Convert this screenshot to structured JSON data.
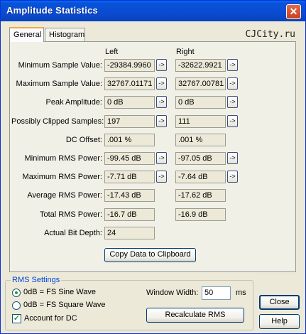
{
  "window": {
    "title": "Amplitude Statistics",
    "close_glyph": "✕"
  },
  "tabs": [
    {
      "label": "General",
      "active": true
    },
    {
      "label": "Histogram",
      "active": false
    }
  ],
  "watermark": "CJCity.ru",
  "columns": {
    "left": "Left",
    "right": "Right"
  },
  "arrow_label": "->",
  "rows": [
    {
      "label": "Minimum Sample Value:",
      "left": "-29384.9960",
      "right": "-32622.9921",
      "has_arrow": true
    },
    {
      "label": "Maximum Sample Value:",
      "left": "32767.01171",
      "right": "32767.00781",
      "has_arrow": true
    },
    {
      "label": "Peak Amplitude:",
      "left": "0 dB",
      "right": "0 dB",
      "has_arrow": true
    },
    {
      "label": "Possibly Clipped Samples:",
      "left": "197",
      "right": "111",
      "has_arrow": true
    },
    {
      "label": "DC Offset:",
      "left": ".001 %",
      "right": ".001 %",
      "has_arrow": false
    },
    {
      "label": "Minimum RMS Power:",
      "left": "-99.45 dB",
      "right": "-97.05 dB",
      "has_arrow": true
    },
    {
      "label": "Maximum RMS Power:",
      "left": "-7.71 dB",
      "right": "-7.64 dB",
      "has_arrow": true
    },
    {
      "label": "Average RMS Power:",
      "left": "-17.43 dB",
      "right": "-17.62 dB",
      "has_arrow": false
    },
    {
      "label": "Total RMS Power:",
      "left": "-16.7 dB",
      "right": "-16.9 dB",
      "has_arrow": false
    },
    {
      "label": "Actual Bit Depth:",
      "left": "24",
      "right": null,
      "has_arrow": false
    }
  ],
  "copy_button": "Copy Data to Clipboard",
  "rms_settings": {
    "title": "RMS Settings",
    "options": [
      {
        "label": "0dB = FS Sine Wave",
        "selected": true
      },
      {
        "label": "0dB = FS Square Wave",
        "selected": false
      }
    ],
    "account_dc": {
      "label": "Account for DC",
      "checked": true
    },
    "window_width_label": "Window Width:",
    "window_width_value": "50",
    "window_width_unit": "ms",
    "recalc_button": "Recalculate RMS"
  },
  "buttons": {
    "close": "Close",
    "help": "Help"
  },
  "colors": {
    "title_bar": "#0753d8",
    "group_title": "#0046d5",
    "tab_highlight": "#f3a93b",
    "check_green": "#21a121"
  }
}
